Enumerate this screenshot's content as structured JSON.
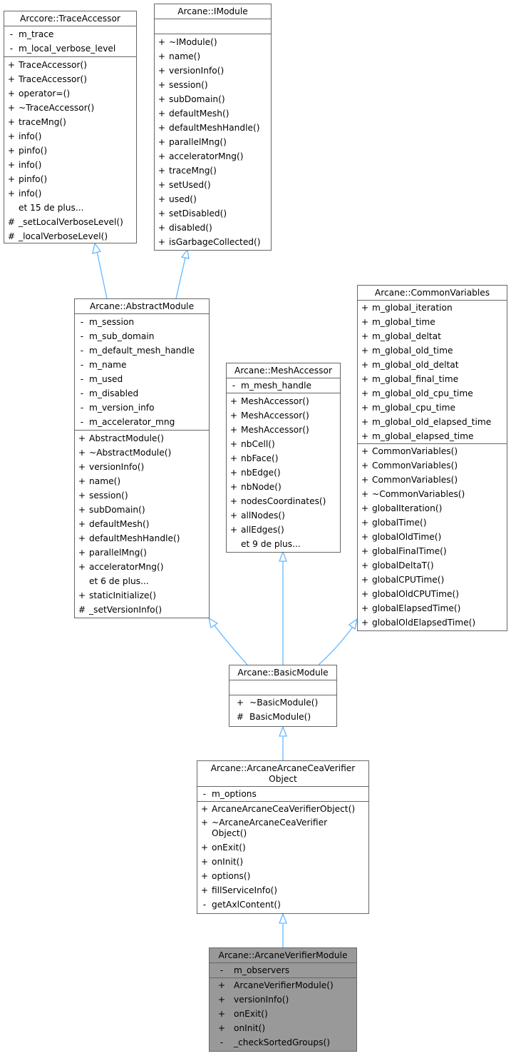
{
  "diagram": {
    "type": "class-inheritance-graph",
    "edge_color": "#63b8ff",
    "border_color": "#666666",
    "highlight_fill": "#999999",
    "nodes": {
      "trace_accessor": {
        "title": "Arccore::TraceAccessor",
        "attributes": [
          {
            "vis": "-",
            "name": "m_trace"
          },
          {
            "vis": "-",
            "name": "m_local_verbose_level"
          }
        ],
        "methods": [
          {
            "vis": "+",
            "name": "TraceAccessor()"
          },
          {
            "vis": "+",
            "name": "TraceAccessor()"
          },
          {
            "vis": "+",
            "name": "operator=()"
          },
          {
            "vis": "+",
            "name": "~TraceAccessor()"
          },
          {
            "vis": "+",
            "name": "traceMng()"
          },
          {
            "vis": "+",
            "name": "info()"
          },
          {
            "vis": "+",
            "name": "pinfo()"
          },
          {
            "vis": "+",
            "name": "info()"
          },
          {
            "vis": "+",
            "name": "pinfo()"
          },
          {
            "vis": "+",
            "name": "info()"
          },
          {
            "vis": "",
            "name": "et 15 de plus..."
          },
          {
            "vis": "#",
            "name": "_setLocalVerboseLevel()"
          },
          {
            "vis": "#",
            "name": "_localVerboseLevel()"
          }
        ]
      },
      "imodule": {
        "title": "Arcane::IModule",
        "attributes": [],
        "methods": [
          {
            "vis": "+",
            "name": "~IModule()"
          },
          {
            "vis": "+",
            "name": "name()"
          },
          {
            "vis": "+",
            "name": "versionInfo()"
          },
          {
            "vis": "+",
            "name": "session()"
          },
          {
            "vis": "+",
            "name": "subDomain()"
          },
          {
            "vis": "+",
            "name": "defaultMesh()"
          },
          {
            "vis": "+",
            "name": "defaultMeshHandle()"
          },
          {
            "vis": "+",
            "name": "parallelMng()"
          },
          {
            "vis": "+",
            "name": "acceleratorMng()"
          },
          {
            "vis": "+",
            "name": "traceMng()"
          },
          {
            "vis": "+",
            "name": "setUsed()"
          },
          {
            "vis": "+",
            "name": "used()"
          },
          {
            "vis": "+",
            "name": "setDisabled()"
          },
          {
            "vis": "+",
            "name": "disabled()"
          },
          {
            "vis": "+",
            "name": "isGarbageCollected()"
          }
        ]
      },
      "abstract_module": {
        "title": "Arcane::AbstractModule",
        "attributes": [
          {
            "vis": "-",
            "name": "m_session"
          },
          {
            "vis": "-",
            "name": "m_sub_domain"
          },
          {
            "vis": "-",
            "name": "m_default_mesh_handle"
          },
          {
            "vis": "-",
            "name": "m_name"
          },
          {
            "vis": "-",
            "name": "m_used"
          },
          {
            "vis": "-",
            "name": "m_disabled"
          },
          {
            "vis": "-",
            "name": "m_version_info"
          },
          {
            "vis": "-",
            "name": "m_accelerator_mng"
          }
        ],
        "methods": [
          {
            "vis": "+",
            "name": "AbstractModule()"
          },
          {
            "vis": "+",
            "name": "~AbstractModule()"
          },
          {
            "vis": "+",
            "name": "versionInfo()"
          },
          {
            "vis": "+",
            "name": "name()"
          },
          {
            "vis": "+",
            "name": "session()"
          },
          {
            "vis": "+",
            "name": "subDomain()"
          },
          {
            "vis": "+",
            "name": "defaultMesh()"
          },
          {
            "vis": "+",
            "name": "defaultMeshHandle()"
          },
          {
            "vis": "+",
            "name": "parallelMng()"
          },
          {
            "vis": "+",
            "name": "acceleratorMng()"
          },
          {
            "vis": "",
            "name": "et 6 de plus..."
          },
          {
            "vis": "+",
            "name": "staticInitialize()"
          },
          {
            "vis": "#",
            "name": "_setVersionInfo()"
          }
        ]
      },
      "mesh_accessor": {
        "title": "Arcane::MeshAccessor",
        "attributes": [
          {
            "vis": "-",
            "name": "m_mesh_handle"
          }
        ],
        "methods": [
          {
            "vis": "+",
            "name": "MeshAccessor()"
          },
          {
            "vis": "+",
            "name": "MeshAccessor()"
          },
          {
            "vis": "+",
            "name": "MeshAccessor()"
          },
          {
            "vis": "+",
            "name": "nbCell()"
          },
          {
            "vis": "+",
            "name": "nbFace()"
          },
          {
            "vis": "+",
            "name": "nbEdge()"
          },
          {
            "vis": "+",
            "name": "nbNode()"
          },
          {
            "vis": "+",
            "name": "nodesCoordinates()"
          },
          {
            "vis": "+",
            "name": "allNodes()"
          },
          {
            "vis": "+",
            "name": "allEdges()"
          },
          {
            "vis": "",
            "name": "et 9 de plus..."
          }
        ]
      },
      "common_variables": {
        "title": "Arcane::CommonVariables",
        "attributes": [
          {
            "vis": "+",
            "name": "m_global_iteration"
          },
          {
            "vis": "+",
            "name": "m_global_time"
          },
          {
            "vis": "+",
            "name": "m_global_deltat"
          },
          {
            "vis": "+",
            "name": "m_global_old_time"
          },
          {
            "vis": "+",
            "name": "m_global_old_deltat"
          },
          {
            "vis": "+",
            "name": "m_global_final_time"
          },
          {
            "vis": "+",
            "name": "m_global_old_cpu_time"
          },
          {
            "vis": "+",
            "name": "m_global_cpu_time"
          },
          {
            "vis": "+",
            "name": "m_global_old_elapsed_time"
          },
          {
            "vis": "+",
            "name": "m_global_elapsed_time"
          }
        ],
        "methods": [
          {
            "vis": "+",
            "name": "CommonVariables()"
          },
          {
            "vis": "+",
            "name": "CommonVariables()"
          },
          {
            "vis": "+",
            "name": "CommonVariables()"
          },
          {
            "vis": "+",
            "name": "~CommonVariables()"
          },
          {
            "vis": "+",
            "name": "globalIteration()"
          },
          {
            "vis": "+",
            "name": "globalTime()"
          },
          {
            "vis": "+",
            "name": "globalOldTime()"
          },
          {
            "vis": "+",
            "name": "globalFinalTime()"
          },
          {
            "vis": "+",
            "name": "globalDeltaT()"
          },
          {
            "vis": "+",
            "name": "globalCPUTime()"
          },
          {
            "vis": "+",
            "name": "globalOldCPUTime()"
          },
          {
            "vis": "+",
            "name": "globalElapsedTime()"
          },
          {
            "vis": "+",
            "name": "globalOldElapsedTime()"
          }
        ]
      },
      "basic_module": {
        "title": "Arcane::BasicModule",
        "attributes": [],
        "methods": [
          {
            "vis": "+",
            "name": "~BasicModule()"
          },
          {
            "vis": "#",
            "name": "BasicModule()"
          }
        ]
      },
      "cea_verifier_object": {
        "title_line1": "Arcane::ArcaneArcaneCeaVerifier",
        "title_line2": "Object",
        "attributes": [
          {
            "vis": "-",
            "name": "m_options"
          }
        ],
        "methods": [
          {
            "vis": "+",
            "name": "ArcaneArcaneCeaVerifierObject()"
          },
          {
            "vis": "+",
            "name": "~ArcaneArcaneCeaVerifier\nObject()"
          },
          {
            "vis": "+",
            "name": "onExit()"
          },
          {
            "vis": "+",
            "name": "onInit()"
          },
          {
            "vis": "+",
            "name": "options()"
          },
          {
            "vis": "+",
            "name": "fillServiceInfo()"
          },
          {
            "vis": "-",
            "name": "getAxlContent()"
          }
        ]
      },
      "verifier_module": {
        "title": "Arcane::ArcaneVerifierModule",
        "attributes": [
          {
            "vis": "-",
            "name": "m_observers"
          }
        ],
        "methods": [
          {
            "vis": "+",
            "name": "ArcaneVerifierModule()"
          },
          {
            "vis": "+",
            "name": "versionInfo()"
          },
          {
            "vis": "+",
            "name": "onExit()"
          },
          {
            "vis": "+",
            "name": "onInit()"
          },
          {
            "vis": "-",
            "name": "_checkSortedGroups()"
          }
        ]
      }
    },
    "edges": [
      {
        "from": "abstract_module",
        "to": "trace_accessor",
        "kind": "inheritance"
      },
      {
        "from": "abstract_module",
        "to": "imodule",
        "kind": "inheritance"
      },
      {
        "from": "basic_module",
        "to": "abstract_module",
        "kind": "inheritance"
      },
      {
        "from": "basic_module",
        "to": "mesh_accessor",
        "kind": "inheritance"
      },
      {
        "from": "basic_module",
        "to": "common_variables",
        "kind": "inheritance"
      },
      {
        "from": "cea_verifier_object",
        "to": "basic_module",
        "kind": "inheritance"
      },
      {
        "from": "verifier_module",
        "to": "cea_verifier_object",
        "kind": "inheritance"
      }
    ]
  }
}
